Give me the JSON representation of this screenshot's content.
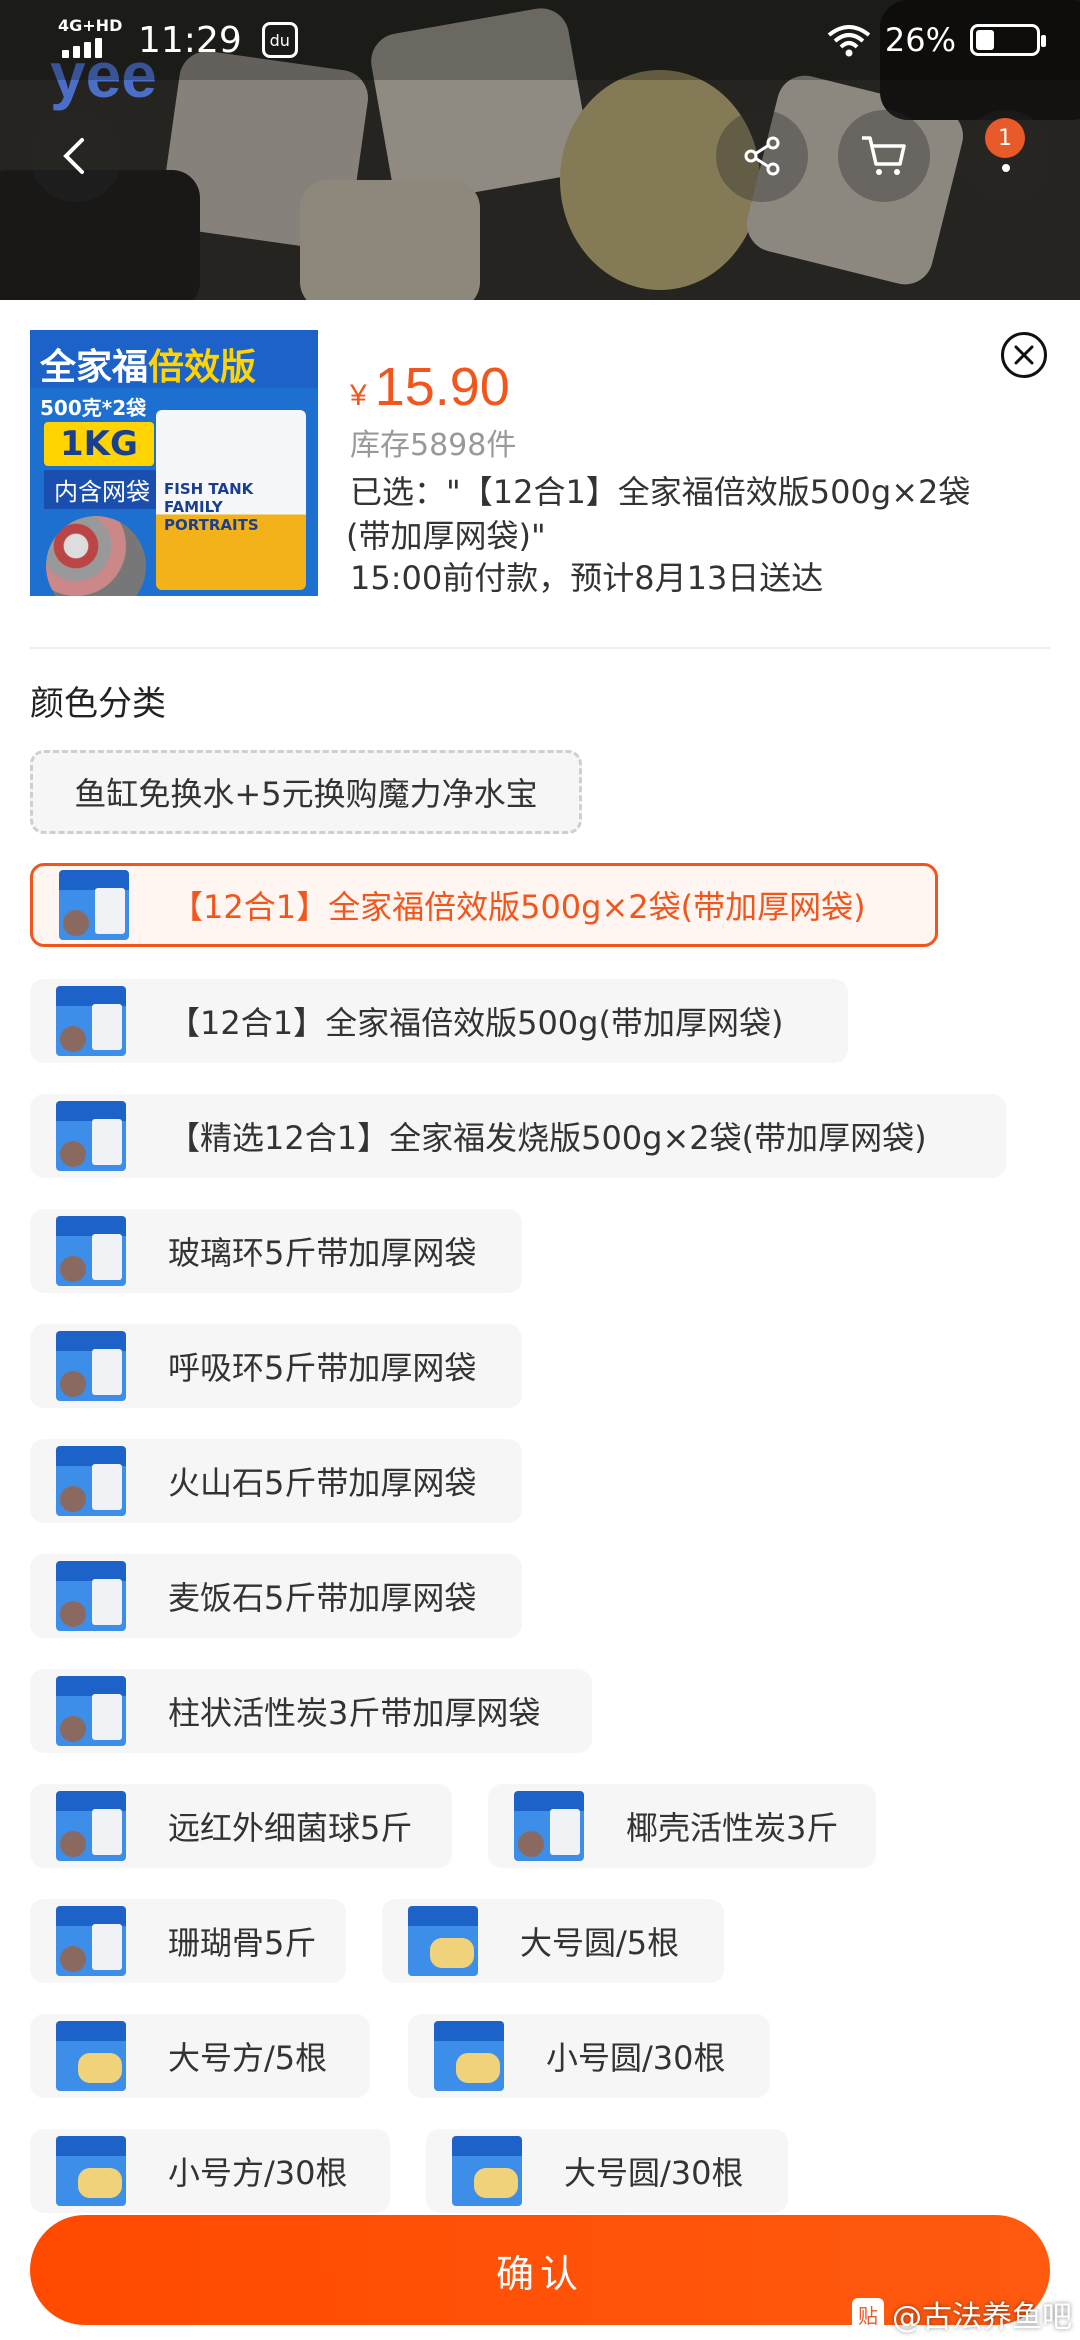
{
  "status_bar": {
    "network": "4G+HD",
    "time": "11:29",
    "app_icon_label": "du",
    "battery": "26%"
  },
  "banner": {
    "logo_text": "yee",
    "cart_count": "1"
  },
  "product": {
    "thumb": {
      "title_a": "全家福",
      "title_b": "倍效版",
      "sub": "500克*2袋",
      "weight": "1KG",
      "net": "内含网袋",
      "bag_text": "FISH TANK FAMILY PORTRAITS"
    },
    "currency": "¥",
    "price": "15.90",
    "stock": "库存5898件",
    "selected_line1": "已选：\"【12合1】全家福倍效版500g×2袋",
    "selected_line2": "(带加厚网袋)\"",
    "delivery": "15:00前付款，预计8月13日送达"
  },
  "section_title": "颜色分类",
  "options": [
    {
      "label": "鱼缸免换水+5元换购魔力净水宝"
    },
    {
      "label": "【12合1】全家福倍效版500g×2袋(带加厚网袋)"
    },
    {
      "label": "【12合1】全家福倍效版500g(带加厚网袋)"
    },
    {
      "label": "【精选12合1】全家福发烧版500g×2袋(带加厚网袋)"
    },
    {
      "label": "玻璃环5斤带加厚网袋"
    },
    {
      "label": "呼吸环5斤带加厚网袋"
    },
    {
      "label": "火山石5斤带加厚网袋"
    },
    {
      "label": "麦饭石5斤带加厚网袋"
    },
    {
      "label": "柱状活性炭3斤带加厚网袋"
    },
    {
      "label": "远红外细菌球5斤"
    },
    {
      "label": "椰壳活性炭3斤"
    },
    {
      "label": "珊瑚骨5斤"
    },
    {
      "label": "大号圆/5根"
    },
    {
      "label": "大号方/5根"
    },
    {
      "label": "小号圆/30根"
    },
    {
      "label": "小号方/30根"
    },
    {
      "label": "大号圆/30根"
    }
  ],
  "confirm_label": "确认",
  "watermark": {
    "badge": "贴",
    "text": "@古法养鱼吧"
  },
  "colors": {
    "accent": "#f2561d",
    "button": "#ff4a00"
  }
}
